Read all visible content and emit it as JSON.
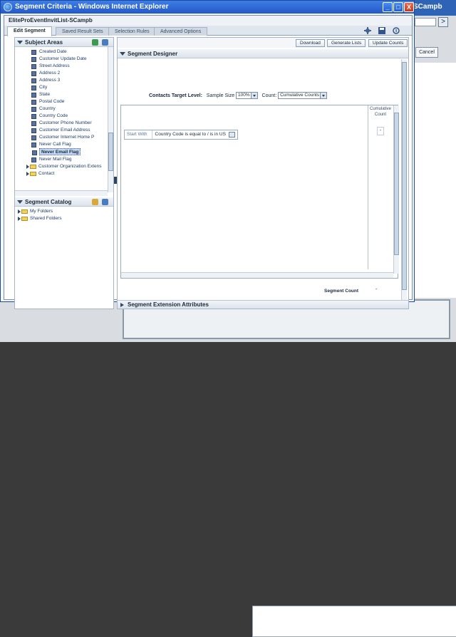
{
  "window": {
    "title": "Segment Criteria - Windows Internet Explorer",
    "min": "_",
    "max": "□",
    "close": "X"
  },
  "background": {
    "title_fragment": "SCampb",
    "cancel_label": "Cancel",
    "go_label": ">"
  },
  "content_title": "EliteProEventInvitList-SCampb",
  "tabs": [
    {
      "label": "Edit Segment",
      "active": true
    },
    {
      "label": "Saved Result Sets",
      "active": false
    },
    {
      "label": "Selection Rules",
      "active": false
    },
    {
      "label": "Advanced Options",
      "active": false
    }
  ],
  "subject_areas": {
    "title": "Subject Areas",
    "items": [
      "Created Date",
      "Customer Update Date",
      "Street Address",
      "Address 2",
      "Address 3",
      "City",
      "State",
      "Postal Code",
      "Country",
      "Country Code",
      "Customer Phone Number",
      "Customer Email Address",
      "Customer Internet Home P",
      "Never Call Flag",
      "Never Email Flag",
      "Never Mail Flag"
    ],
    "selected_item": "Never Email Flag",
    "folders": [
      "Customer Organization Extens",
      "Contact"
    ]
  },
  "segment_catalog": {
    "title": "Segment Catalog",
    "folders": [
      "My Folders",
      "Shared Folders"
    ]
  },
  "designer": {
    "title": "Segment Designer",
    "buttons": {
      "download": "Download",
      "generate": "Generate Lists",
      "update": "Update Counts"
    },
    "target_level_label": "Contacts Target Level:",
    "sample_size_label": "Sample Size",
    "sample_size_value": "100%",
    "count_label": "Count:",
    "count_value": "Cumulative Counts",
    "criteria_start": "Start With",
    "criteria_text": "Country Code is equal to / is in US",
    "cumulative_header": "Cumulative Count",
    "cumulative_value": "-",
    "segment_count_label": "Segment Count",
    "segment_count_value": "-",
    "extension_title": "Segment Extension Attributes"
  }
}
